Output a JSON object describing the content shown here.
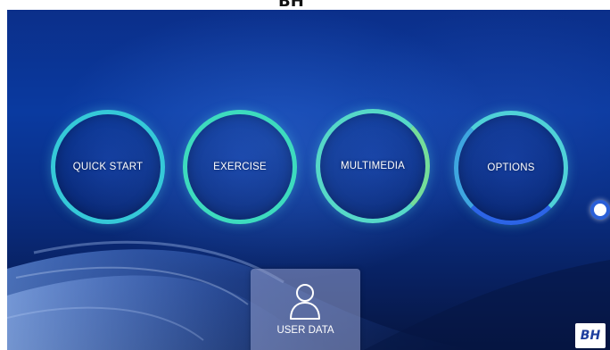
{
  "top_caption": "BH",
  "menu": {
    "quick_start": "QUICK START",
    "exercise": "EXERCISE",
    "multimedia": "MULTIMEDIA",
    "options": "OPTIONS"
  },
  "user_data": {
    "label": "USER DATA",
    "icon": "user-icon"
  },
  "brand": {
    "logo": "BH"
  },
  "colors": {
    "background": "#0a2f86",
    "ring": "#3fd6c4",
    "ring_blue": "#2c64e6",
    "tile": "#969ecd"
  }
}
